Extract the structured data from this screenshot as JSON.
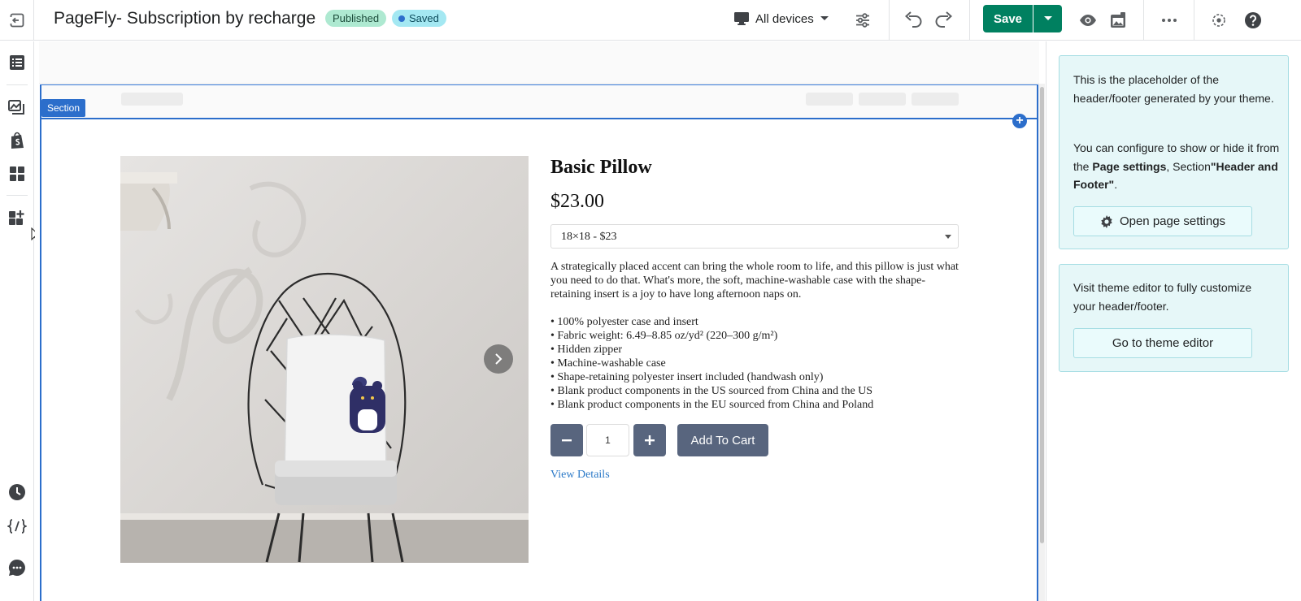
{
  "topbar": {
    "title": "PageFly- Subscription by recharge",
    "status_published": "Published",
    "status_saved": "Saved",
    "device_selector": "All devices",
    "save_label": "Save"
  },
  "canvas": {
    "section_tag": "Section",
    "product": {
      "title": "Basic Pillow",
      "price": "$23.00",
      "variant_selected": "18×18 - $23",
      "description": "A strategically placed accent can bring the whole room to life, and this pillow is just what you need to do that. What's more, the soft, machine-washable case with the shape-retaining insert is a joy to have long afternoon naps on.",
      "features": [
        "• 100% polyester case and insert",
        "• Fabric weight: 6.49–8.85 oz/yd² (220–300 g/m²)",
        "• Hidden zipper",
        "• Machine-washable case",
        "• Shape-retaining polyester insert included (handwash only)",
        "• Blank product components in the US sourced from China and the US",
        "• Blank product components in the EU sourced from China and Poland"
      ],
      "quantity": "1",
      "add_to_cart": "Add To Cart",
      "view_details": "View Details"
    }
  },
  "right_panel": {
    "card1": {
      "text1": "This is the placeholder of the header/footer generated by your theme.",
      "text2_prefix": "You can configure to show or hide it from the ",
      "text2_bold1": "Page settings",
      "text2_mid": ", Section",
      "text2_bold2": "\"Header and Footer\"",
      "text2_suffix": ".",
      "button": "Open page settings"
    },
    "card2": {
      "text": "Visit theme editor to fully customize your header/footer.",
      "button": "Go to theme editor"
    }
  },
  "icons": {
    "back": "exit-icon",
    "devices": "desktop-icon",
    "settings": "sliders-icon",
    "undo": "undo-icon",
    "redo": "redo-icon",
    "preview": "eye-icon",
    "publish_preview": "screenshot-icon",
    "more": "ellipsis-icon",
    "target": "target-icon",
    "help": "help-icon",
    "rail": [
      "list-icon",
      "gallery-icon",
      "shopify-bag-icon",
      "grid-icon",
      "add-block-icon",
      "history-clock-icon",
      "code-icon",
      "chat-icon"
    ]
  },
  "colors": {
    "primary_green": "#008060",
    "section_blue": "#2c6ecb",
    "published_badge": "#aee9d1",
    "saved_badge": "#a4e8f2",
    "product_button": "#58657e",
    "info_card_bg": "#e6f7f8",
    "link_blue": "#2c7ac8"
  }
}
